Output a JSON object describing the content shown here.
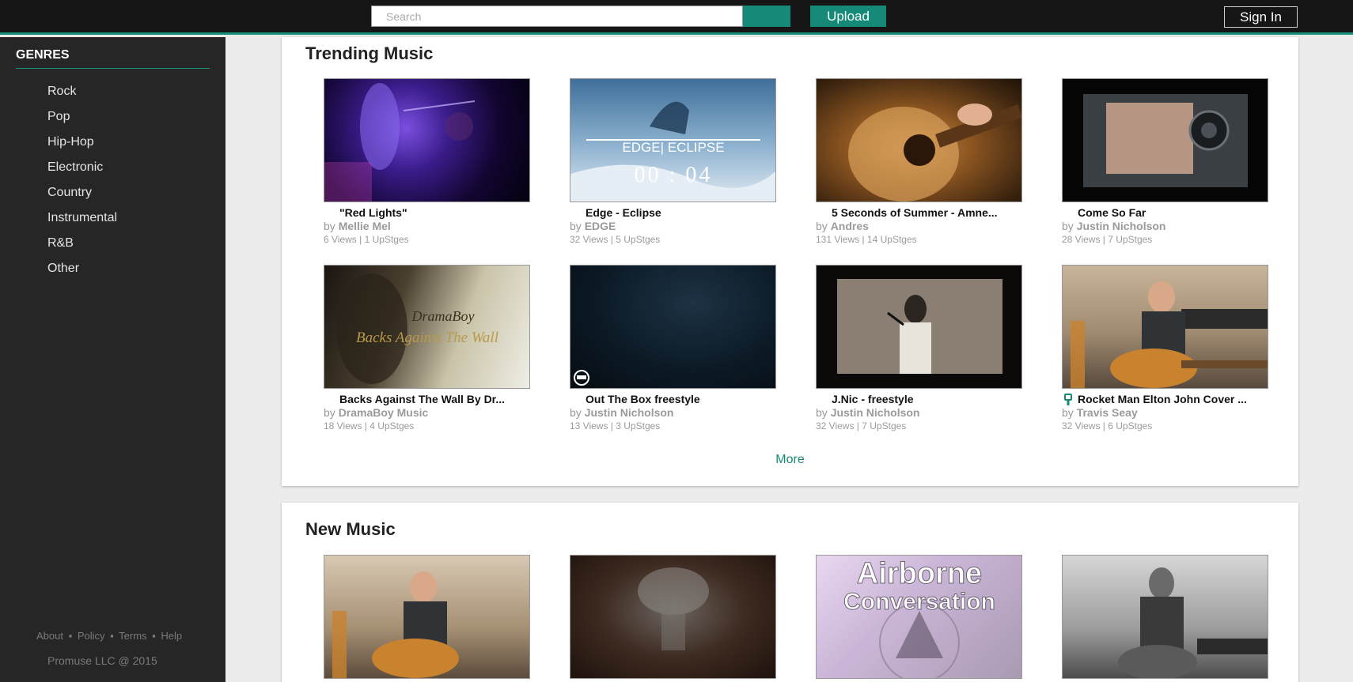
{
  "header": {
    "search_placeholder": "Search",
    "upload_label": "Upload",
    "signin_label": "Sign In"
  },
  "sidebar": {
    "title": "GENRES",
    "genres": [
      "Rock",
      "Pop",
      "Hip-Hop",
      "Electronic",
      "Country",
      "Instrumental",
      "R&B",
      "Other"
    ],
    "footer_links": [
      "About",
      "Policy",
      "Terms",
      "Help"
    ],
    "footer_sep": "▪",
    "copyright": "Promuse LLC @ 2015"
  },
  "trending": {
    "title": "Trending Music",
    "more_label": "More",
    "by_label": "by",
    "items": [
      {
        "title": "\"Red Lights\"",
        "artist": "Mellie Mel",
        "stats": "6 Views | 1 UpStges",
        "thumb_text": ""
      },
      {
        "title": "Edge - Eclipse",
        "artist": "EDGE",
        "stats": "32 Views | 5 UpStges",
        "thumb_text": "EDGE| ECLIPSE",
        "thumb_text2": "00 : 04"
      },
      {
        "title": "5 Seconds of Summer - Amne...",
        "artist": "Andres",
        "stats": "131 Views | 14 UpStges",
        "thumb_text": ""
      },
      {
        "title": "Come So Far",
        "artist": "Justin Nicholson",
        "stats": "28 Views | 7 UpStges",
        "thumb_text": ""
      },
      {
        "title": "Backs Against The Wall By Dr...",
        "artist": "DramaBoy Music",
        "stats": "18 Views | 4 UpStges",
        "thumb_text": "DramaBoy",
        "thumb_text2": "Backs Against The Wall"
      },
      {
        "title": "Out The Box freestyle",
        "artist": "Justin Nicholson",
        "stats": "13 Views | 3 UpStges",
        "thumb_text": ""
      },
      {
        "title": "J.Nic - freestyle",
        "artist": "Justin Nicholson",
        "stats": "32 Views | 7 UpStges",
        "thumb_text": ""
      },
      {
        "title": "Rocket Man Elton John Cover ...",
        "artist": "Travis Seay",
        "stats": "32 Views | 6 UpStges",
        "thumb_text": ""
      }
    ]
  },
  "new_music": {
    "title": "New Music",
    "items": [
      {
        "thumb_text": ""
      },
      {
        "thumb_text": ""
      },
      {
        "thumb_text": "Airborne",
        "thumb_text2": "Conversation"
      },
      {
        "thumb_text": ""
      }
    ]
  },
  "colors": {
    "accent": "#168a78",
    "topbar": "#161616",
    "sidebar": "#262626"
  }
}
